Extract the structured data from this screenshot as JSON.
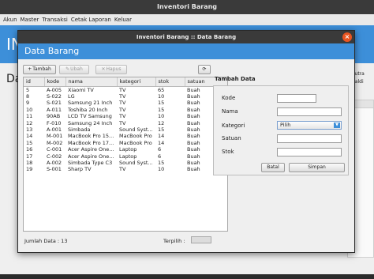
{
  "main": {
    "title": "Inventori Barang",
    "menu": [
      "Akun",
      "Master",
      "Transaksi",
      "Cetak Laporan",
      "Keluar"
    ],
    "blue_title": "IN",
    "da_text": "Da",
    "right_text_1": "Putra",
    "right_text_2": "naldi"
  },
  "dialog": {
    "title": "Inventori Barang :: Data Barang",
    "close_glyph": "×",
    "header": "Data Barang",
    "toolbar": {
      "tambah": "Tambah",
      "ubah": "Ubah",
      "hapus": "Hapus",
      "refresh_glyph": "⟳"
    },
    "table": {
      "columns": [
        "id",
        "kode",
        "nama",
        "kategori",
        "stok",
        "satuan"
      ],
      "rows": [
        [
          "5",
          "A-005",
          "Xiaomi TV",
          "TV",
          "65",
          "Buah"
        ],
        [
          "8",
          "S-022",
          "LG",
          "TV",
          "10",
          "Buah"
        ],
        [
          "9",
          "S-021",
          "Samsung 21 Inch",
          "TV",
          "15",
          "Buah"
        ],
        [
          "10",
          "A-011",
          "Toshiba 20 Inch",
          "TV",
          "15",
          "Buah"
        ],
        [
          "11",
          "90AB",
          "LCD TV Samsung",
          "TV",
          "10",
          "Buah"
        ],
        [
          "12",
          "F-010",
          "Samsung 24 Inch",
          "TV",
          "12",
          "Buah"
        ],
        [
          "13",
          "A-001",
          "Simbada",
          "Sound Syst...",
          "15",
          "Buah"
        ],
        [
          "14",
          "M-001",
          "MacBook Pro 15...",
          "MacBook Pro",
          "14",
          "Buah"
        ],
        [
          "15",
          "M-002",
          "MacBook Pro 17...",
          "MacBook Pro",
          "14",
          "Buah"
        ],
        [
          "16",
          "C-001",
          "Acer Aspire One...",
          "Laptop",
          "6",
          "Buah"
        ],
        [
          "17",
          "C-002",
          "Acer Aspire One...",
          "Laptop",
          "6",
          "Buah"
        ],
        [
          "18",
          "A-002",
          "Simbada Type C3",
          "Sound Syst...",
          "15",
          "Buah"
        ],
        [
          "19",
          "S-001",
          "Sharp TV",
          "TV",
          "10",
          "Buah"
        ]
      ]
    },
    "footer": {
      "jumlah": "Jumlah Data : 13",
      "terpilih": "Terpilih :"
    },
    "form": {
      "heading": "Tambah Data",
      "kode_label": "Kode",
      "nama_label": "Nama",
      "kategori_label": "Kategori",
      "kategori_value": "Pilih",
      "satuan_label": "Satuan",
      "stok_label": "Stok",
      "batal": "Batal",
      "simpan": "Simpan"
    }
  }
}
